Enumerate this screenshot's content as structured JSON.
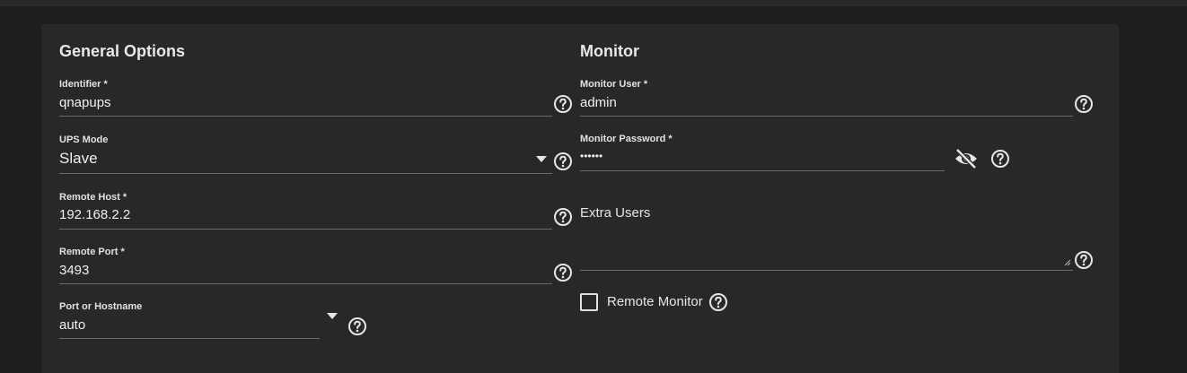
{
  "general": {
    "title": "General Options",
    "identifier": {
      "label": "Identifier *",
      "value": "qnapups"
    },
    "ups_mode": {
      "label": "UPS Mode",
      "value": "Slave"
    },
    "remote_host": {
      "label": "Remote Host *",
      "value": "192.168.2.2"
    },
    "remote_port": {
      "label": "Remote Port *",
      "value": "3493"
    },
    "port_or_hostname": {
      "label": "Port or Hostname",
      "value": "auto"
    }
  },
  "monitor": {
    "title": "Monitor",
    "monitor_user": {
      "label": "Monitor User *",
      "value": "admin"
    },
    "monitor_password": {
      "label": "Monitor Password *",
      "value": "••••••"
    },
    "extra_users": {
      "label": "Extra Users",
      "value": ""
    },
    "remote_monitor": {
      "label": "Remote Monitor",
      "checked": false
    }
  },
  "icons": {
    "help": "help-circle-icon",
    "dropdown": "caret-down-icon",
    "visibility": "eye-off-icon"
  },
  "colors": {
    "background": "#1e1e1e",
    "card": "#282828",
    "text": "#e6e6e6",
    "underline": "#6a6a6a"
  }
}
